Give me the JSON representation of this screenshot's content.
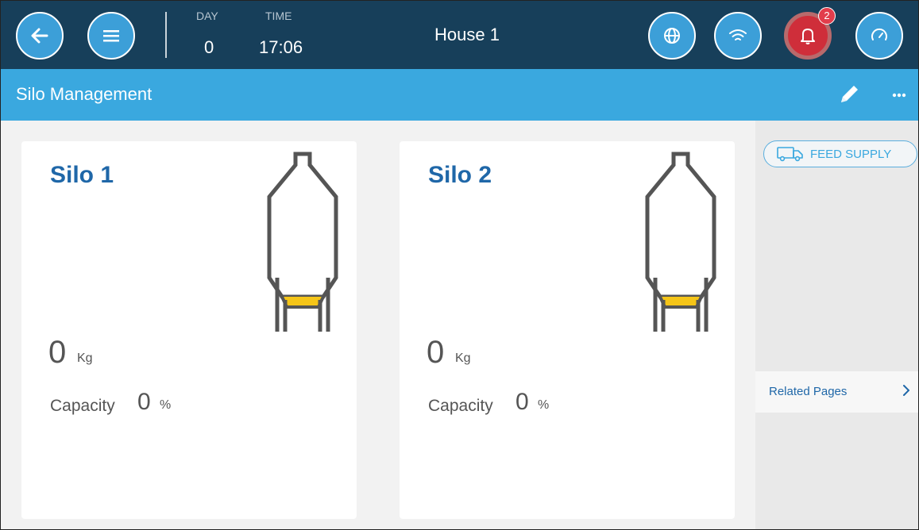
{
  "topbar": {
    "day_label": "DAY",
    "day_value": "0",
    "time_label": "TIME",
    "time_value": "17:06",
    "house_title": "House 1",
    "alarm_count": "2",
    "icons": [
      "back-arrow-icon",
      "menu-icon",
      "globe-icon",
      "wifi-icon",
      "bell-icon",
      "gauge-icon"
    ],
    "colors": {
      "bar": "#173f5a",
      "button": "#3c9fd8",
      "alarm": "#cf2e3a"
    }
  },
  "subheader": {
    "title": "Silo Management",
    "icons": [
      "pencil-icon",
      "more-icon"
    ],
    "color": "#3aa8df"
  },
  "silos": [
    {
      "name": "Silo 1",
      "amount": "0",
      "amount_unit": "Kg",
      "capacity_label": "Capacity",
      "capacity_value": "0",
      "capacity_unit": "%"
    },
    {
      "name": "Silo 2",
      "amount": "0",
      "amount_unit": "Kg",
      "capacity_label": "Capacity",
      "capacity_value": "0",
      "capacity_unit": "%"
    }
  ],
  "sidebar": {
    "feed_supply_label": "FEED SUPPLY",
    "related_label": "Related Pages"
  },
  "colors": {
    "silo_outline": "#555555",
    "feed_fill": "#f5c518",
    "silo_name": "#1f67a8"
  }
}
